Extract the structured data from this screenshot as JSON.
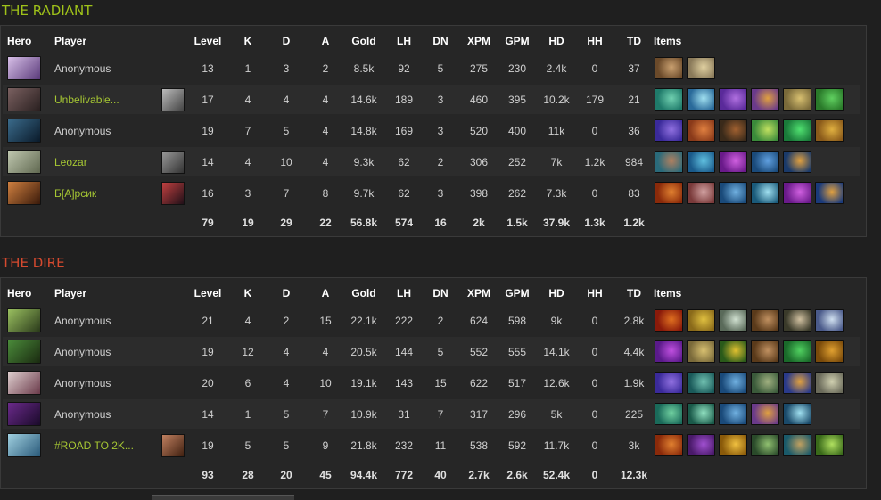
{
  "headers": {
    "hero": "Hero",
    "player": "Player",
    "level": "Level",
    "k": "K",
    "d": "D",
    "a": "A",
    "gold": "Gold",
    "lh": "LH",
    "dn": "DN",
    "xpm": "XPM",
    "gpm": "GPM",
    "hd": "HD",
    "hh": "HH",
    "td": "TD",
    "items": "Items"
  },
  "radiant": {
    "title": "THE RADIANT",
    "rows": [
      {
        "player": "Anonymous",
        "linked": false,
        "avatar": null,
        "level": "13",
        "k": "1",
        "d": "3",
        "a": "2",
        "gold": "8.5k",
        "lh": "92",
        "dn": "5",
        "xpm": "275",
        "gpm": "230",
        "hd": "2.4k",
        "hh": "0",
        "td": "37",
        "hero_colors": [
          "#d8c0e8",
          "#5a3a7a"
        ],
        "items": [
          [
            "#6b4a2a",
            "#c9a070"
          ],
          [
            "#8a7a5a",
            "#e0d0a0"
          ]
        ]
      },
      {
        "player": "Unbelivable...",
        "linked": true,
        "avatar": [
          "#bbbbbb",
          "#444444"
        ],
        "level": "17",
        "k": "4",
        "d": "4",
        "a": "4",
        "gold": "14.6k",
        "lh": "189",
        "dn": "3",
        "xpm": "460",
        "gpm": "395",
        "hd": "10.2k",
        "hh": "179",
        "td": "21",
        "hero_colors": [
          "#7a6060",
          "#2a2020"
        ],
        "items": [
          [
            "#1f7a6a",
            "#70d0b0"
          ],
          [
            "#2a6a9a",
            "#a0e0f0"
          ],
          [
            "#5a2a9a",
            "#b070e0"
          ],
          [
            "#6a3a8a",
            "#e0a040"
          ],
          [
            "#7a6a3a",
            "#d8c070"
          ],
          [
            "#2a7a2a",
            "#60d060"
          ]
        ]
      },
      {
        "player": "Anonymous",
        "linked": false,
        "avatar": null,
        "level": "19",
        "k": "7",
        "d": "5",
        "a": "4",
        "gold": "14.8k",
        "lh": "169",
        "dn": "3",
        "xpm": "520",
        "gpm": "400",
        "hd": "11k",
        "hh": "0",
        "td": "36",
        "hero_colors": [
          "#3a6a8a",
          "#0a1a2a"
        ],
        "items": [
          [
            "#3a2a9a",
            "#9070e0"
          ],
          [
            "#8a3a1a",
            "#e08040"
          ],
          [
            "#3a2a1a",
            "#a06030"
          ],
          [
            "#3a8a3a",
            "#c0e060"
          ],
          [
            "#1a7a3a",
            "#50e070"
          ],
          [
            "#8a5a1a",
            "#e0b040"
          ]
        ]
      },
      {
        "player": "Leozar",
        "linked": true,
        "avatar": [
          "#999999",
          "#333333"
        ],
        "level": "14",
        "k": "4",
        "d": "10",
        "a": "4",
        "gold": "9.3k",
        "lh": "62",
        "dn": "2",
        "xpm": "306",
        "gpm": "252",
        "hd": "7k",
        "hh": "1.2k",
        "td": "984",
        "hero_colors": [
          "#c0c8b0",
          "#606850"
        ],
        "items": [
          [
            "#2a6a7a",
            "#b08060"
          ],
          [
            "#1a5a8a",
            "#60c0e0"
          ],
          [
            "#6a1a8a",
            "#d060e0"
          ],
          [
            "#1a4a7a",
            "#60a0e0"
          ],
          [
            "#1a3a6a",
            "#e0a040"
          ]
        ]
      },
      {
        "player": "Б[А]рсик",
        "linked": true,
        "avatar": [
          "#c04040",
          "#201018"
        ],
        "level": "16",
        "k": "3",
        "d": "7",
        "a": "8",
        "gold": "9.7k",
        "lh": "62",
        "dn": "3",
        "xpm": "398",
        "gpm": "262",
        "hd": "7.3k",
        "hh": "0",
        "td": "83",
        "hero_colors": [
          "#d08040",
          "#3a1a0a"
        ],
        "items": [
          [
            "#8a2a0a",
            "#e08030"
          ],
          [
            "#7a3a3a",
            "#d0a0a0"
          ],
          [
            "#1a4a7a",
            "#70b0e0"
          ],
          [
            "#1a5a7a",
            "#a0e0f0"
          ],
          [
            "#6a1a8a",
            "#d060e0"
          ],
          [
            "#1a3a7a",
            "#e0a040"
          ]
        ]
      }
    ],
    "totals": {
      "level": "79",
      "k": "19",
      "d": "29",
      "a": "22",
      "gold": "56.8k",
      "lh": "574",
      "dn": "16",
      "xpm": "2k",
      "gpm": "1.5k",
      "hd": "37.9k",
      "hh": "1.3k",
      "td": "1.2k"
    }
  },
  "dire": {
    "title": "THE DIRE",
    "rows": [
      {
        "player": "Anonymous",
        "linked": false,
        "avatar": null,
        "level": "21",
        "k": "4",
        "d": "2",
        "a": "15",
        "gold": "22.1k",
        "lh": "222",
        "dn": "2",
        "xpm": "624",
        "gpm": "598",
        "hd": "9k",
        "hh": "0",
        "td": "2.8k",
        "hero_colors": [
          "#9ac060",
          "#2a3a1a"
        ],
        "items": [
          [
            "#8a1a0a",
            "#e07020"
          ],
          [
            "#8a6a1a",
            "#e0c040"
          ],
          [
            "#5a6a5a",
            "#d0e0d0"
          ],
          [
            "#5a3a1a",
            "#c09060"
          ],
          [
            "#3a3a2a",
            "#d0c0a0"
          ],
          [
            "#4a5a8a",
            "#d0e0f0"
          ]
        ]
      },
      {
        "player": "Anonymous",
        "linked": false,
        "avatar": null,
        "level": "19",
        "k": "12",
        "d": "4",
        "a": "4",
        "gold": "20.5k",
        "lh": "144",
        "dn": "5",
        "xpm": "552",
        "gpm": "555",
        "hd": "14.1k",
        "hh": "0",
        "td": "4.4k",
        "hero_colors": [
          "#4a8a3a",
          "#1a2a10"
        ],
        "items": [
          [
            "#5a1a8a",
            "#c050e0"
          ],
          [
            "#7a6a3a",
            "#d8c070"
          ],
          [
            "#2a5a1a",
            "#e0c030"
          ],
          [
            "#5a3a1a",
            "#c09060"
          ],
          [
            "#1a6a2a",
            "#50d060"
          ],
          [
            "#7a4a0a",
            "#e0a030"
          ]
        ]
      },
      {
        "player": "Anonymous",
        "linked": false,
        "avatar": null,
        "level": "20",
        "k": "6",
        "d": "4",
        "a": "10",
        "gold": "19.1k",
        "lh": "143",
        "dn": "15",
        "xpm": "622",
        "gpm": "517",
        "hd": "12.6k",
        "hh": "0",
        "td": "1.9k",
        "hero_colors": [
          "#e0d0d0",
          "#6a3a4a"
        ],
        "items": [
          [
            "#3a2a9a",
            "#9070e0"
          ],
          [
            "#1a5a5a",
            "#70c0b0"
          ],
          [
            "#1a4a7a",
            "#70b0e0"
          ],
          [
            "#3a5a3a",
            "#a0b080"
          ],
          [
            "#2a3a8a",
            "#e0a040"
          ],
          [
            "#6a6a5a",
            "#d0d0b0"
          ]
        ]
      },
      {
        "player": "Anonymous",
        "linked": false,
        "avatar": null,
        "level": "14",
        "k": "1",
        "d": "5",
        "a": "7",
        "gold": "10.9k",
        "lh": "31",
        "dn": "7",
        "xpm": "317",
        "gpm": "296",
        "hd": "5k",
        "hh": "0",
        "td": "225",
        "hero_colors": [
          "#6a2a8a",
          "#1a0a2a"
        ],
        "items": [
          [
            "#1a6a5a",
            "#70d0a0"
          ],
          [
            "#1a5a4a",
            "#90e0c0"
          ],
          [
            "#1a4a7a",
            "#70b0e0"
          ],
          [
            "#6a3a8a",
            "#e0a040"
          ],
          [
            "#1a4a6a",
            "#a0e0f0"
          ]
        ]
      },
      {
        "player": "#ROAD TO 2K...",
        "linked": true,
        "avatar": [
          "#c08060",
          "#402010"
        ],
        "level": "19",
        "k": "5",
        "d": "5",
        "a": "9",
        "gold": "21.8k",
        "lh": "232",
        "dn": "11",
        "xpm": "538",
        "gpm": "592",
        "hd": "11.7k",
        "hh": "0",
        "td": "3k",
        "hero_colors": [
          "#a0d0e0",
          "#2a5a7a"
        ],
        "items": [
          [
            "#8a2a0a",
            "#e08030"
          ],
          [
            "#4a1a6a",
            "#a050d0"
          ],
          [
            "#8a5a0a",
            "#f0c040"
          ],
          [
            "#2a4a2a",
            "#90c070"
          ],
          [
            "#1a5a6a",
            "#c0a060"
          ],
          [
            "#3a6a1a",
            "#b0e060"
          ]
        ]
      }
    ],
    "totals": {
      "level": "93",
      "k": "28",
      "d": "20",
      "a": "45",
      "gold": "94.4k",
      "lh": "772",
      "dn": "40",
      "xpm": "2.7k",
      "gpm": "2.6k",
      "hd": "52.4k",
      "hh": "0",
      "td": "12.3k"
    }
  }
}
